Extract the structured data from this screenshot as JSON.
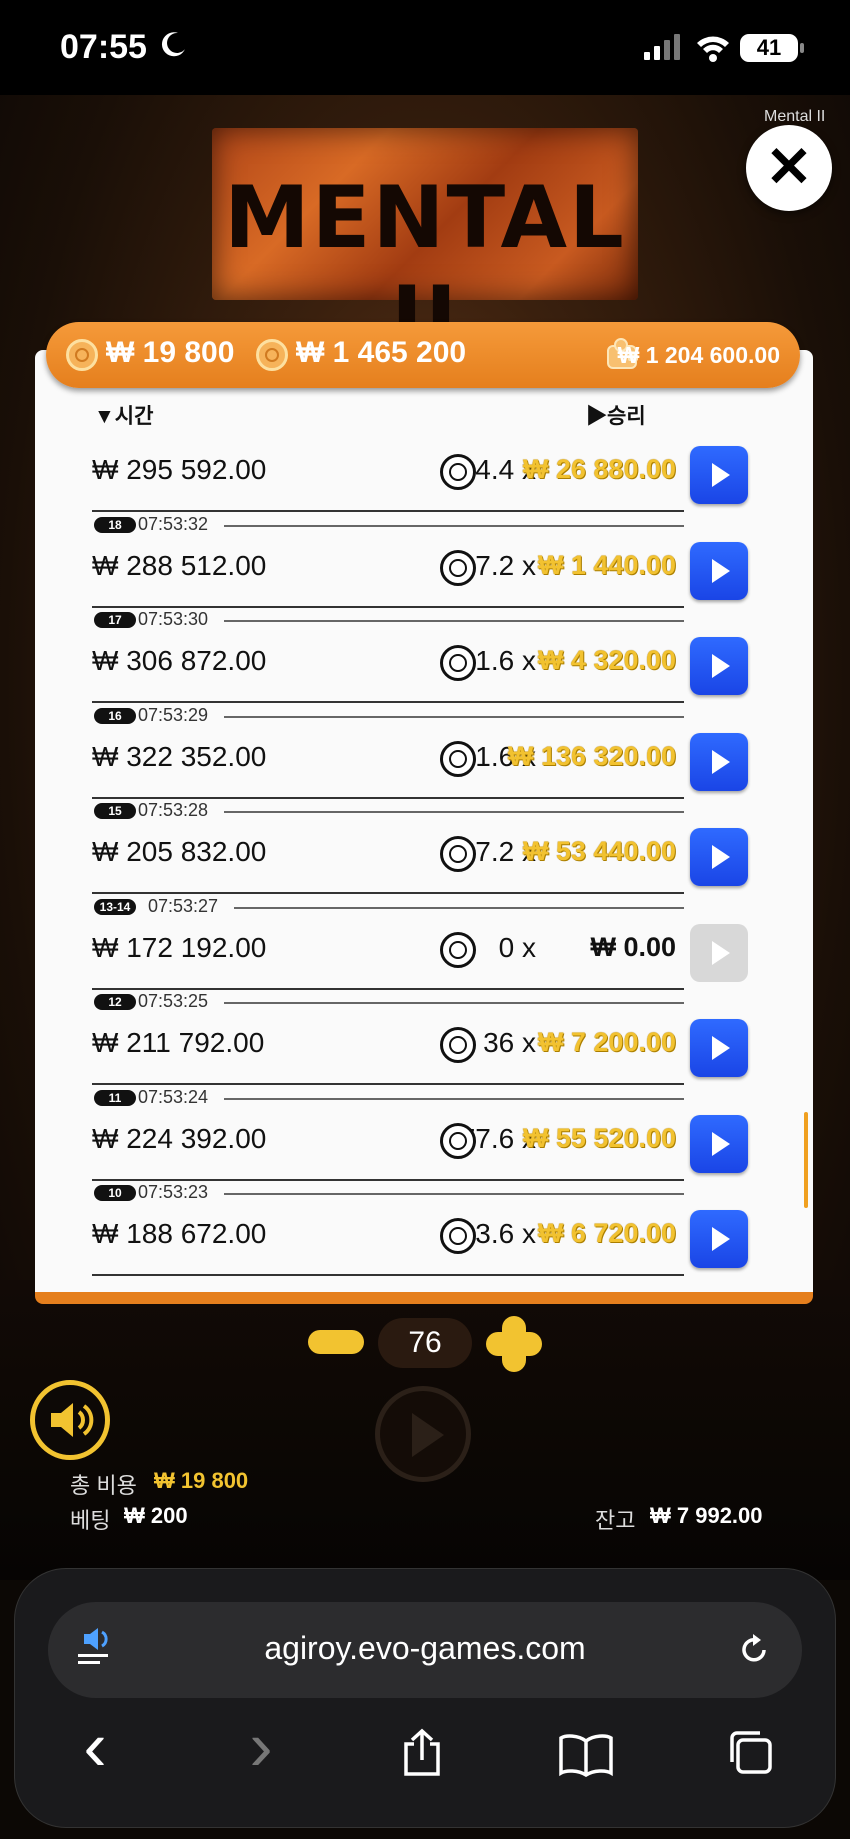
{
  "status": {
    "time": "07:55",
    "battery": "41"
  },
  "game": {
    "logo_text": "MENTAL II",
    "title_tag": "Mental II",
    "close_icon": "close-icon"
  },
  "header_bar": {
    "cost": "₩ 19 800",
    "total": "₩ 1 465 200",
    "balance": "₩ 1 204 600.00"
  },
  "table": {
    "col_time": "▼시간",
    "col_win": "▶승리",
    "rows": [
      {
        "badge": "",
        "time": "",
        "amount": "₩ 295 592.00",
        "mult": "134.4 x",
        "win": "₩ 26 880.00",
        "playable": true
      },
      {
        "badge": "18",
        "time": "07:53:32",
        "amount": "₩ 288 512.00",
        "mult": "7.2 x",
        "win": "₩ 1 440.00",
        "playable": true
      },
      {
        "badge": "17",
        "time": "07:53:30",
        "amount": "₩ 306 872.00",
        "mult": "21.6 x",
        "win": "₩ 4 320.00",
        "playable": true
      },
      {
        "badge": "16",
        "time": "07:53:29",
        "amount": "₩ 322 352.00",
        "mult": "681.6 x",
        "win": "₩ 136 320.00",
        "playable": true
      },
      {
        "badge": "15",
        "time": "07:53:28",
        "amount": "₩ 205 832.00",
        "mult": "267.2 x",
        "win": "₩ 53 440.00",
        "playable": true
      },
      {
        "badge": "13-14",
        "time": "07:53:27",
        "amount": "₩ 172 192.00",
        "mult": "0 x",
        "win": "₩ 0.00",
        "playable": false
      },
      {
        "badge": "12",
        "time": "07:53:25",
        "amount": "₩ 211 792.00",
        "mult": "36 x",
        "win": "₩ 7 200.00",
        "playable": true
      },
      {
        "badge": "11",
        "time": "07:53:24",
        "amount": "₩ 224 392.00",
        "mult": "277.6 x",
        "win": "₩ 55 520.00",
        "playable": true
      },
      {
        "badge": "10",
        "time": "07:53:23",
        "amount": "₩ 188 672.00",
        "mult": "33.6 x",
        "win": "₩ 6 720.00",
        "playable": true
      }
    ]
  },
  "controls": {
    "count": "76",
    "total_cost_label": "총 비용",
    "total_cost_value": "₩ 19 800",
    "bet_label": "베팅",
    "bet_value": "₩ 200",
    "balance_label": "잔고",
    "balance_value": "₩ 7 992.00"
  },
  "browser": {
    "url": "agiroy.evo-games.com",
    "back": "‹",
    "forward": "›"
  }
}
